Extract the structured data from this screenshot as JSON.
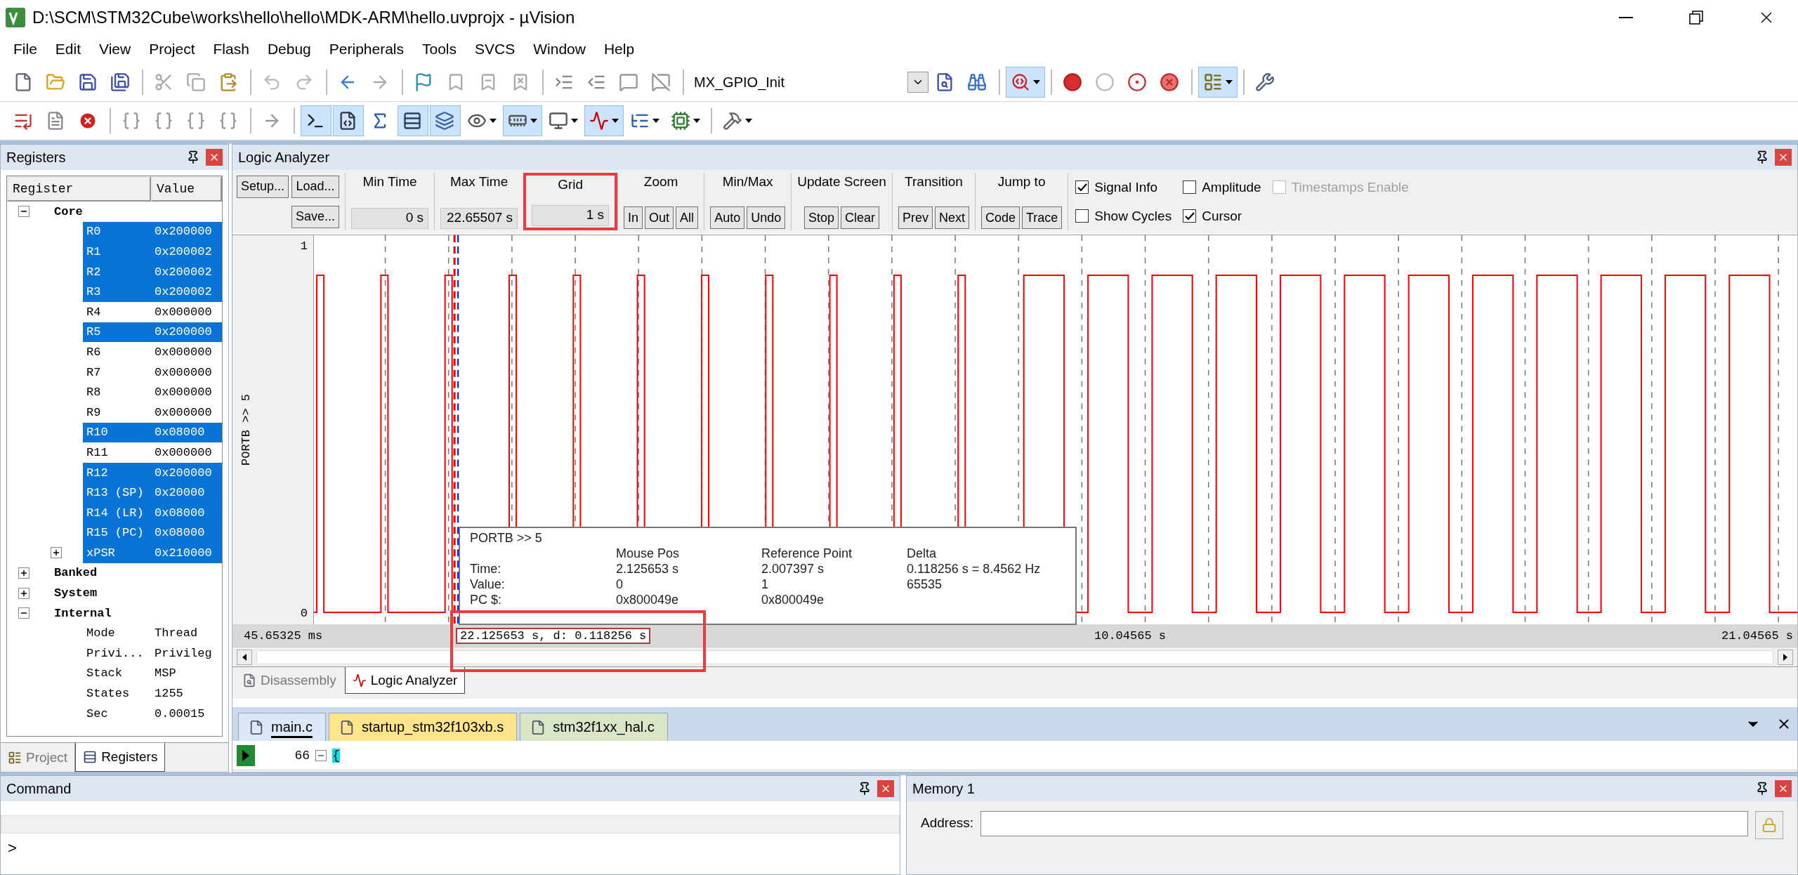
{
  "window": {
    "title": "D:\\SCM\\STM32Cube\\works\\hello\\hello\\MDK-ARM\\hello.uvprojx - µVision"
  },
  "menu": [
    "File",
    "Edit",
    "View",
    "Project",
    "Flash",
    "Debug",
    "Peripherals",
    "Tools",
    "SVCS",
    "Window",
    "Help"
  ],
  "file_toolbar": {
    "buttons_left": [
      {
        "pressed": false
      },
      {
        "pressed": false
      },
      {
        "pressed": false
      },
      {
        "pressed": false
      },
      {
        "pressed": false
      },
      {
        "pressed": false
      },
      {
        "pressed": false
      },
      {
        "pressed": false
      },
      {
        "pressed": false
      },
      {
        "pressed": false
      },
      {
        "pressed": false
      },
      {
        "pressed": false
      },
      {
        "pressed": false
      },
      {
        "pressed": false
      },
      {
        "pressed": false
      },
      {
        "pressed": false
      },
      {
        "pressed": false
      },
      {
        "pressed": false
      },
      {
        "pressed": false
      }
    ],
    "function_box": "MX_GPIO_Init",
    "buttons_right": [
      {
        "pressed": false
      },
      {
        "pressed": false
      },
      {
        "pressed": true
      },
      {
        "pressed": false
      },
      {
        "pressed": false
      },
      {
        "pressed": false
      },
      {
        "pressed": false
      },
      {
        "pressed": true
      },
      {
        "pressed": false
      }
    ]
  },
  "debug_toolbar": [
    {
      "pressed": false
    },
    {
      "pressed": false
    },
    {
      "pressed": false
    },
    {
      "pressed": false
    },
    {
      "pressed": false
    },
    {
      "pressed": false
    },
    {
      "pressed": false
    },
    {
      "pressed": false
    },
    {
      "pressed": true
    },
    {
      "pressed": true
    },
    {
      "pressed": false
    },
    {
      "pressed": true
    },
    {
      "pressed": true
    },
    {
      "pressed": false
    },
    {
      "pressed": true
    },
    {
      "pressed": false
    },
    {
      "pressed": true
    },
    {
      "pressed": false
    },
    {
      "pressed": false
    },
    {
      "pressed": false
    }
  ],
  "registers_panel": {
    "title": "Registers",
    "columns": [
      "Register",
      "Value"
    ],
    "tree": [
      {
        "name": "Core",
        "expanded": true,
        "children": [
          {
            "name": "R0",
            "value": "0x200000",
            "selected": true
          },
          {
            "name": "R1",
            "value": "0x200002",
            "selected": true
          },
          {
            "name": "R2",
            "value": "0x200002",
            "selected": true
          },
          {
            "name": "R3",
            "value": "0x200002",
            "selected": true
          },
          {
            "name": "R4",
            "value": "0x000000",
            "selected": false
          },
          {
            "name": "R5",
            "value": "0x200000",
            "selected": true
          },
          {
            "name": "R6",
            "value": "0x000000",
            "selected": false
          },
          {
            "name": "R7",
            "value": "0x000000",
            "selected": false
          },
          {
            "name": "R8",
            "value": "0x000000",
            "selected": false
          },
          {
            "name": "R9",
            "value": "0x000000",
            "selected": false
          },
          {
            "name": "R10",
            "value": "0x08000",
            "selected": true
          },
          {
            "name": "R11",
            "value": "0x000000",
            "selected": false
          },
          {
            "name": "R12",
            "value": "0x200000",
            "selected": true
          },
          {
            "name": "R13 (SP)",
            "value": "0x20000",
            "selected": true
          },
          {
            "name": "R14 (LR)",
            "value": "0x08000",
            "selected": true
          },
          {
            "name": "R15 (PC)",
            "value": "0x08000",
            "selected": true
          },
          {
            "name": "xPSR",
            "value": "0x210000",
            "selected": true,
            "expanded": false
          }
        ]
      },
      {
        "name": "Banked",
        "expanded": false
      },
      {
        "name": "System",
        "expanded": false
      },
      {
        "name": "Internal",
        "expanded": true,
        "children": [
          {
            "name": "Mode",
            "value": "Thread",
            "selected": false
          },
          {
            "name": "Privi...",
            "value": "Privileg",
            "selected": false
          },
          {
            "name": "Stack",
            "value": "MSP",
            "selected": false
          },
          {
            "name": "States",
            "value": "1255",
            "selected": false
          },
          {
            "name": "Sec",
            "value": "0.00015",
            "selected": false
          }
        ]
      }
    ],
    "tabs": [
      {
        "label": "Project",
        "selected": false
      },
      {
        "label": "Registers",
        "selected": true
      }
    ]
  },
  "logic_analyzer": {
    "title": "Logic Analyzer",
    "file_buttons": {
      "setup": "Setup...",
      "load": "Load...",
      "save": "Save..."
    },
    "groups": [
      {
        "kind": "display",
        "title": "Min Time",
        "value": "0 s",
        "highlighted": false
      },
      {
        "kind": "display",
        "title": "Max Time",
        "value": "22.65507 s",
        "highlighted": false
      },
      {
        "kind": "display",
        "title": "Grid",
        "value": "1 s",
        "highlighted": true
      },
      {
        "kind": "buttons",
        "title": "Zoom",
        "buttons": [
          "In",
          "Out",
          "All"
        ],
        "highlighted": false
      },
      {
        "kind": "buttons",
        "title": "Min/Max",
        "buttons": [
          "Auto",
          "Undo"
        ],
        "highlighted": false
      },
      {
        "kind": "buttons",
        "title": "Update Screen",
        "buttons": [
          "Stop",
          "Clear"
        ],
        "highlighted": false
      },
      {
        "kind": "buttons",
        "title": "Transition",
        "buttons": [
          "Prev",
          "Next"
        ],
        "highlighted": false
      },
      {
        "kind": "buttons",
        "title": "Jump to",
        "buttons": [
          "Code",
          "Trace"
        ],
        "highlighted": false
      }
    ],
    "options": [
      {
        "label": "Signal Info",
        "checked": true,
        "disabled": false
      },
      {
        "label": "Show Cycles",
        "checked": false,
        "disabled": false
      },
      {
        "label": "Amplitude",
        "checked": false,
        "disabled": false
      },
      {
        "label": "Cursor",
        "checked": true,
        "disabled": false
      },
      {
        "label": "Timestamps Enable",
        "checked": false,
        "disabled": true
      }
    ],
    "signal": {
      "name": "PORTB >> 5",
      "high_label": "1",
      "low_label": "0"
    },
    "axis": {
      "start": "45.65325 ms",
      "middle": "10.04565 s",
      "end": "21.04565 s"
    },
    "cursor_readout": {
      "text": "22.125653 s,  d: 0.118256 s",
      "highlighted": true
    },
    "signal_info": {
      "title": "PORTB >> 5",
      "columns": [
        "Mouse Pos",
        "Reference Point",
        "Delta"
      ],
      "rows": [
        {
          "label": "Time:",
          "cells": [
            "2.125653 s",
            "2.007397 s",
            "0.118256 s = 8.4562 Hz"
          ]
        },
        {
          "label": "Value:",
          "cells": [
            "0",
            "1",
            "65535"
          ]
        },
        {
          "label": "PC $:",
          "cells": [
            "0x800049e",
            "0x800049e"
          ]
        }
      ]
    },
    "view_tabs": [
      {
        "label": "Disassembly",
        "selected": false
      },
      {
        "label": "Logic Analyzer",
        "selected": true
      }
    ]
  },
  "editor": {
    "tabs": [
      {
        "label": "main.c",
        "selected": true,
        "color": "#dce8f8"
      },
      {
        "label": "startup_stm32f103xb.s",
        "selected": false,
        "color": "#ffe48c"
      },
      {
        "label": "stm32f1xx_hal.c",
        "selected": false,
        "color": "#d8e6c6"
      }
    ],
    "line": {
      "number": "66",
      "code": "{"
    }
  },
  "command_panel": {
    "title": "Command",
    "prompt": ">"
  },
  "memory_panel": {
    "title": "Memory 1",
    "address_label": "Address:"
  }
}
